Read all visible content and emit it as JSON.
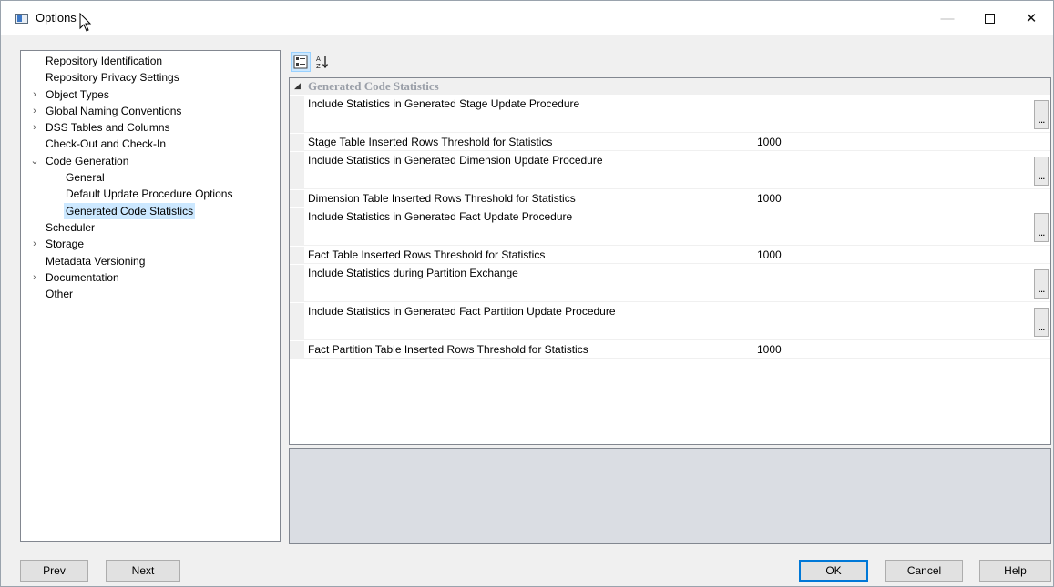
{
  "window": {
    "title": "Options",
    "minimize_symbol": "—",
    "close_symbol": "✕"
  },
  "tree": {
    "items": [
      {
        "label": "Repository Identification",
        "level": 0,
        "expander": ""
      },
      {
        "label": "Repository Privacy Settings",
        "level": 0,
        "expander": ""
      },
      {
        "label": "Object Types",
        "level": 0,
        "expander": "›"
      },
      {
        "label": "Global Naming Conventions",
        "level": 0,
        "expander": "›"
      },
      {
        "label": "DSS Tables and Columns",
        "level": 0,
        "expander": "›"
      },
      {
        "label": "Check-Out and Check-In",
        "level": 0,
        "expander": ""
      },
      {
        "label": "Code Generation",
        "level": 0,
        "expander": "⌄"
      },
      {
        "label": "General",
        "level": 1,
        "expander": ""
      },
      {
        "label": "Default Update Procedure Options",
        "level": 1,
        "expander": ""
      },
      {
        "label": "Generated Code Statistics",
        "level": 1,
        "expander": "",
        "selected": true
      },
      {
        "label": "Scheduler",
        "level": 0,
        "expander": ""
      },
      {
        "label": "Storage",
        "level": 0,
        "expander": "›"
      },
      {
        "label": "Metadata Versioning",
        "level": 0,
        "expander": ""
      },
      {
        "label": "Documentation",
        "level": 0,
        "expander": "›"
      },
      {
        "label": "Other",
        "level": 0,
        "expander": ""
      }
    ]
  },
  "toolbar": {
    "categorized_icon": "categorized-view-icon",
    "alphabetical_icon": "sort-alphabetical-icon"
  },
  "grid": {
    "category": "Generated Code Statistics",
    "rows": [
      {
        "name": "Include Statistics in Generated Stage Update Procedure",
        "value": "",
        "ellipsis": "..."
      },
      {
        "name": "Stage Table Inserted Rows Threshold for Statistics",
        "value": "1000",
        "ellipsis": ""
      },
      {
        "name": "Include Statistics in Generated Dimension Update Procedure",
        "value": "",
        "ellipsis": "..."
      },
      {
        "name": "Dimension Table Inserted Rows Threshold for Statistics",
        "value": "1000",
        "ellipsis": ""
      },
      {
        "name": "Include Statistics in Generated Fact Update Procedure",
        "value": "",
        "ellipsis": "..."
      },
      {
        "name": "Fact Table Inserted Rows Threshold for Statistics",
        "value": "1000",
        "ellipsis": ""
      },
      {
        "name": "Include Statistics during Partition Exchange",
        "value": "",
        "ellipsis": "..."
      },
      {
        "name": "Include Statistics in Generated Fact Partition Update Procedure",
        "value": "",
        "ellipsis": "..."
      },
      {
        "name": "Fact Partition Table Inserted Rows Threshold for Statistics",
        "value": "1000",
        "ellipsis": ""
      }
    ]
  },
  "buttons": {
    "prev": "Prev",
    "next": "Next",
    "ok": "OK",
    "cancel": "Cancel",
    "help": "Help"
  },
  "colors": {
    "selection": "#cce8ff",
    "ok_border": "#0078d7",
    "category_text": "#9a9fa8"
  }
}
